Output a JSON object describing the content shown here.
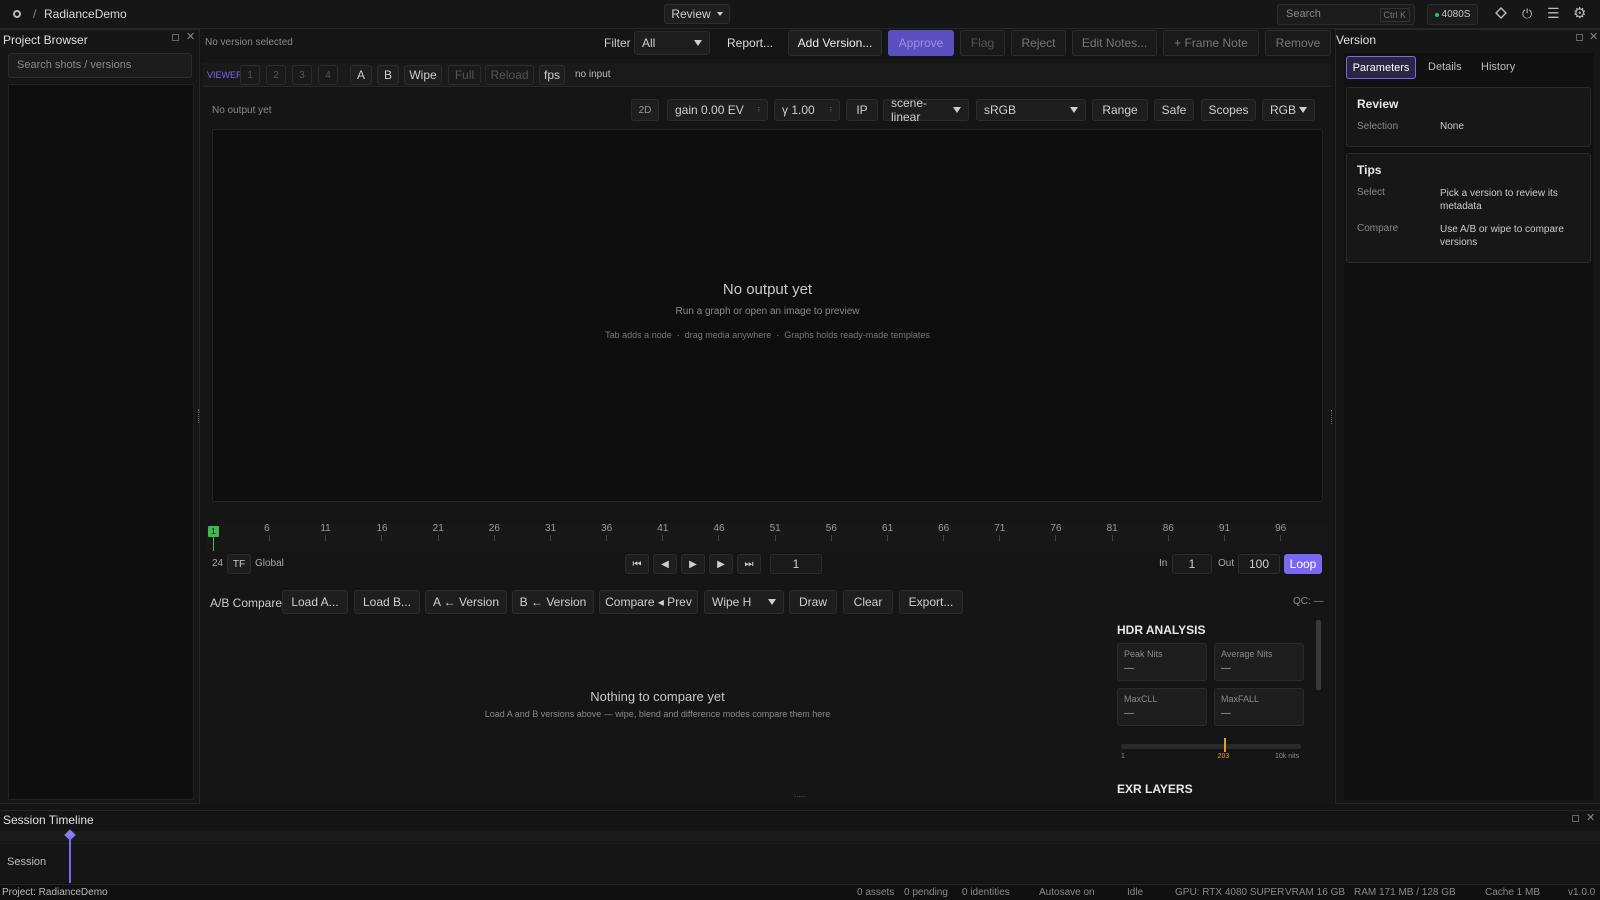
{
  "topbar": {
    "project_name": "RadianceDemo",
    "separator": "/",
    "mode_label": "Review",
    "search_placeholder": "Search",
    "search_shortcut": "Ctrl K",
    "gpu_badge": "4080S"
  },
  "project_browser": {
    "title": "Project Browser",
    "search_placeholder": "Search shots / versions"
  },
  "review_toolbar": {
    "status": "No version selected",
    "filter_label": "Filter",
    "filter_value": "All",
    "report": "Report...",
    "add_version": "Add Version...",
    "approve": "Approve",
    "flag": "Flag",
    "reject": "Reject",
    "edit_notes": "Edit Notes...",
    "frame_note": "+ Frame Note",
    "remove": "Remove"
  },
  "viewer_bar": {
    "label": "VIEWER",
    "slots": [
      "1",
      "2",
      "3",
      "4"
    ],
    "a": "A",
    "b": "B",
    "wipe": "Wipe",
    "full": "Full",
    "reload": "Reload",
    "fps": "fps",
    "input": "no input"
  },
  "view_controls": {
    "status": "No output yet",
    "mode_2d": "2D",
    "gain": "gain 0.00 EV",
    "gamma": "γ 1.00",
    "ip": "IP",
    "colorspace": "scene-linear",
    "display": "sRGB",
    "range": "Range",
    "safe": "Safe",
    "scopes": "Scopes",
    "channels": "RGB"
  },
  "viewport": {
    "headline": "No output yet",
    "subline": "Run a graph or open an image to preview",
    "hints": "Tab adds a node  ·  drag media anywhere  ·  Graphs holds ready-made templates"
  },
  "timeline": {
    "current_marker": "1",
    "ticks": [
      "6",
      "11",
      "16",
      "21",
      "26",
      "31",
      "36",
      "41",
      "46",
      "51",
      "56",
      "61",
      "66",
      "71",
      "76",
      "81",
      "86",
      "91",
      "96"
    ],
    "fps": "24",
    "tf": "TF",
    "scope": "Global",
    "frame": "1",
    "in_label": "In",
    "in_value": "1",
    "out_label": "Out",
    "out_value": "100",
    "loop": "Loop"
  },
  "ab_compare": {
    "label": "A/B Compare:",
    "load_a": "Load A...",
    "load_b": "Load B...",
    "a_version": "A ← Version",
    "b_version": "B ← Version",
    "compare_prev": "Compare ◂ Prev",
    "wipe_mode": "Wipe H",
    "draw": "Draw",
    "clear": "Clear",
    "export": "Export...",
    "qc": "QC: —",
    "empty_title": "Nothing to compare yet",
    "empty_sub": "Load A and B versions above — wipe, blend and difference modes compare them here"
  },
  "hdr": {
    "title": "HDR ANALYSIS",
    "peak_nits_label": "Peak Nits",
    "peak_nits_value": "—",
    "avg_nits_label": "Average Nits",
    "avg_nits_value": "—",
    "maxcll_label": "MaxCLL",
    "maxcll_value": "—",
    "maxfall_label": "MaxFALL",
    "maxfall_value": "—",
    "scale_min": "1",
    "scale_mid": "203",
    "scale_max": "10k nits",
    "marker_fraction": 0.57,
    "exr_title": "EXR LAYERS"
  },
  "version_panel": {
    "title": "Version",
    "tabs": [
      "Parameters",
      "Details",
      "History"
    ],
    "review_title": "Review",
    "selection_label": "Selection",
    "selection_value": "None",
    "tips_title": "Tips",
    "tip1_label": "Select",
    "tip1_text": "Pick a version to review its metadata",
    "tip2_label": "Compare",
    "tip2_text": "Use A/B or wipe to compare versions"
  },
  "session": {
    "title": "Session Timeline",
    "track": "Session"
  },
  "statusbar": {
    "project": "Project: RadianceDemo",
    "assets": "0 assets",
    "pending": "0 pending",
    "identities": "0 identities",
    "autosave": "Autosave on",
    "state": "Idle",
    "gpu": "GPU: RTX 4080 SUPER",
    "vram": "VRAM 16 GB",
    "ram": "RAM 171 MB / 128 GB",
    "cache": "Cache 1 MB",
    "version": "v1.0.0"
  },
  "colors": {
    "accent": "#7a68f5",
    "background": "#141414",
    "timeline_marker": "#3fb950",
    "hdr_marker": "#e0a030"
  }
}
